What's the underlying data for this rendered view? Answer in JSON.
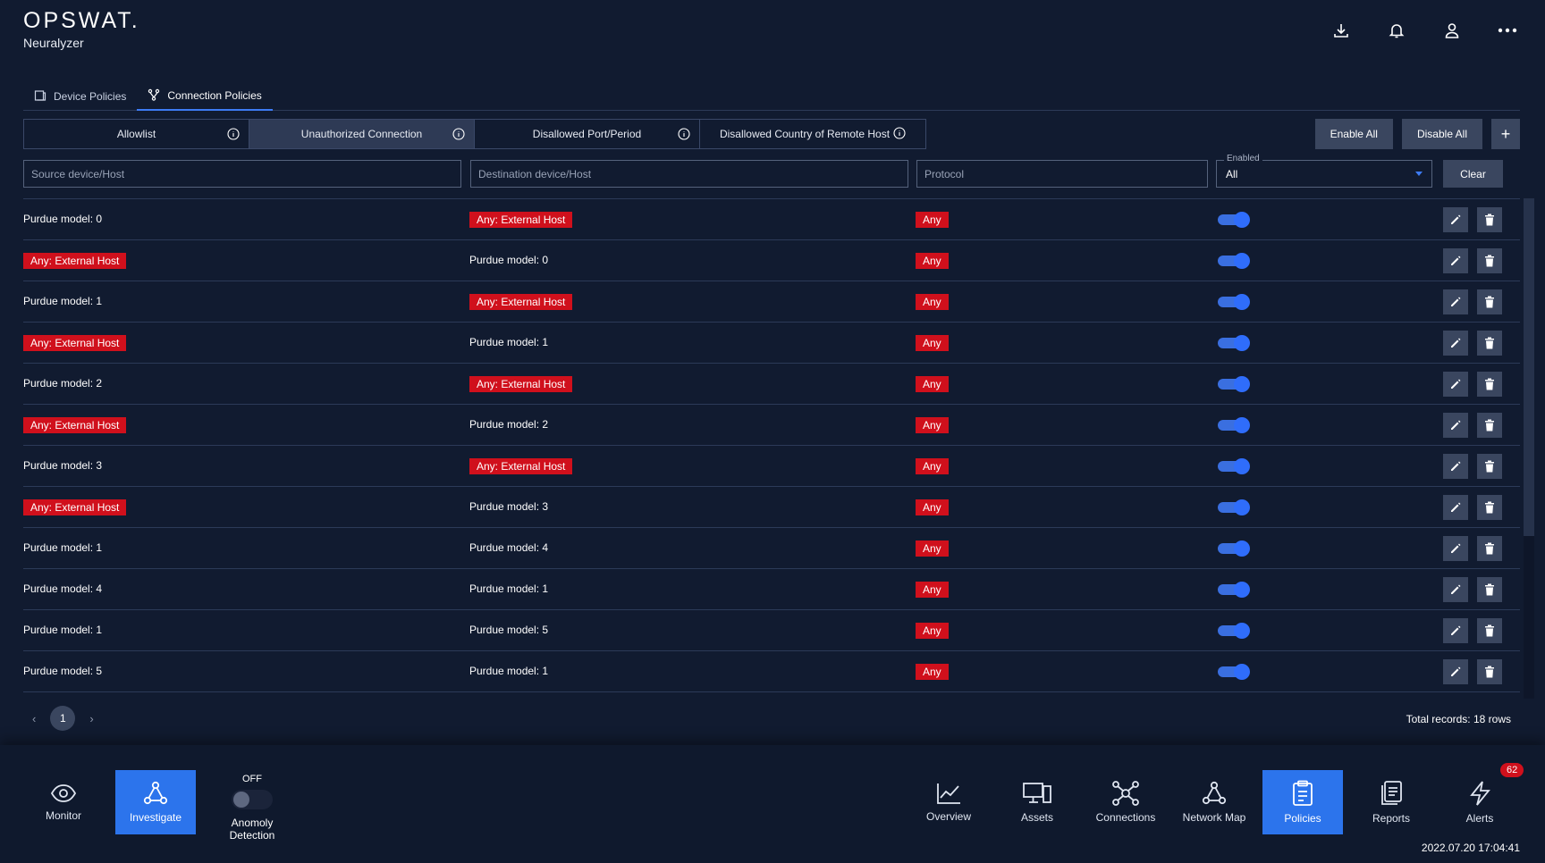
{
  "header": {
    "logo": "OPSWAT.",
    "product": "Neuralyzer",
    "icons": [
      "download-icon",
      "bell-icon",
      "user-icon",
      "more-icon"
    ]
  },
  "tabs": [
    {
      "label": "Device Policies",
      "icon": "device-icon",
      "active": false
    },
    {
      "label": "Connection Policies",
      "icon": "connection-icon",
      "active": true
    }
  ],
  "subtabs": [
    {
      "label": "Allowlist",
      "active": false
    },
    {
      "label": "Unauthorized Connection",
      "active": true
    },
    {
      "label": "Disallowed Port/Period",
      "active": false
    },
    {
      "label": "Disallowed Country of Remote Host",
      "active": false
    }
  ],
  "actions": {
    "enable_all": "Enable All",
    "disable_all": "Disable All",
    "add": "+"
  },
  "filters": {
    "source_placeholder": "Source device/Host",
    "destination_placeholder": "Destination device/Host",
    "protocol_placeholder": "Protocol",
    "enabled_label": "Enabled",
    "enabled_value": "All",
    "clear": "Clear"
  },
  "rows": [
    {
      "source": "Purdue model: 0",
      "source_tag": false,
      "destination": "Any: External Host",
      "destination_tag": true,
      "protocol": "Any",
      "enabled": true
    },
    {
      "source": "Any: External Host",
      "source_tag": true,
      "destination": "Purdue model: 0",
      "destination_tag": false,
      "protocol": "Any",
      "enabled": true
    },
    {
      "source": "Purdue model: 1",
      "source_tag": false,
      "destination": "Any: External Host",
      "destination_tag": true,
      "protocol": "Any",
      "enabled": true
    },
    {
      "source": "Any: External Host",
      "source_tag": true,
      "destination": "Purdue model: 1",
      "destination_tag": false,
      "protocol": "Any",
      "enabled": true
    },
    {
      "source": "Purdue model: 2",
      "source_tag": false,
      "destination": "Any: External Host",
      "destination_tag": true,
      "protocol": "Any",
      "enabled": true
    },
    {
      "source": "Any: External Host",
      "source_tag": true,
      "destination": "Purdue model: 2",
      "destination_tag": false,
      "protocol": "Any",
      "enabled": true
    },
    {
      "source": "Purdue model: 3",
      "source_tag": false,
      "destination": "Any: External Host",
      "destination_tag": true,
      "protocol": "Any",
      "enabled": true
    },
    {
      "source": "Any: External Host",
      "source_tag": true,
      "destination": "Purdue model: 3",
      "destination_tag": false,
      "protocol": "Any",
      "enabled": true
    },
    {
      "source": "Purdue model: 1",
      "source_tag": false,
      "destination": "Purdue model: 4",
      "destination_tag": false,
      "protocol": "Any",
      "enabled": true
    },
    {
      "source": "Purdue model: 4",
      "source_tag": false,
      "destination": "Purdue model: 1",
      "destination_tag": false,
      "protocol": "Any",
      "enabled": true
    },
    {
      "source": "Purdue model: 1",
      "source_tag": false,
      "destination": "Purdue model: 5",
      "destination_tag": false,
      "protocol": "Any",
      "enabled": true
    },
    {
      "source": "Purdue model: 5",
      "source_tag": false,
      "destination": "Purdue model: 1",
      "destination_tag": false,
      "protocol": "Any",
      "enabled": true
    }
  ],
  "pagination": {
    "prev": "‹",
    "page": "1",
    "next": "›",
    "total": "Total records: 18 rows"
  },
  "bottom_nav": {
    "left": [
      {
        "label": "Monitor",
        "icon": "eye-icon",
        "active": false
      },
      {
        "label": "Investigate",
        "icon": "investigate-icon",
        "active": true
      }
    ],
    "anomaly": {
      "state": "OFF",
      "label": "Anomoly Detection"
    },
    "right": [
      {
        "label": "Overview",
        "icon": "chart-icon",
        "active": false
      },
      {
        "label": "Assets",
        "icon": "assets-icon",
        "active": false
      },
      {
        "label": "Connections",
        "icon": "connections-icon",
        "active": false
      },
      {
        "label": "Network Map",
        "icon": "network-map-icon",
        "active": false
      },
      {
        "label": "Policies",
        "icon": "policies-icon",
        "active": true
      },
      {
        "label": "Reports",
        "icon": "reports-icon",
        "active": false
      },
      {
        "label": "Alerts",
        "icon": "alerts-icon",
        "active": false
      }
    ],
    "alerts_badge": "62",
    "timestamp": "2022.07.20 17:04:41"
  },
  "colors": {
    "background": "#111b30",
    "accent": "#2c74ec",
    "tag_red": "#d0101c",
    "button": "#3a465f"
  }
}
